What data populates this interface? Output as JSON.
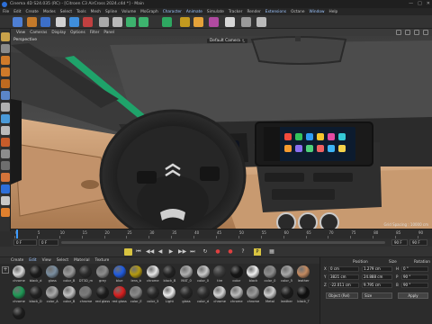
{
  "window": {
    "title": "Cinema 4D S24.035 (RC) - [Citroen C3 AirCross 2024.c4d *] - Main",
    "controls": [
      "—",
      "□",
      "✕"
    ]
  },
  "menu": [
    "File",
    "Edit",
    "Create",
    "Modes",
    "Select",
    "Tools",
    "Mesh",
    "Spline",
    "Volume",
    "MoGraph",
    "Character",
    "Animate",
    "Simulate",
    "Tracker",
    "Render",
    "Extensions",
    "Octane",
    "Window",
    "Help"
  ],
  "viewport": {
    "menu": [
      "View",
      "Cameras",
      "Display",
      "Options",
      "Filter",
      "Panel"
    ],
    "label": "Perspective",
    "camera": "Default Camera ⚬̲",
    "grid_spacing": "Grid Spacing : 10000 cm",
    "screen_apps": [
      "#f04b3c",
      "#33c35a",
      "#2f9cf3",
      "#f7c52d",
      "#e54aa3",
      "#35c9d6",
      "#f39a2f",
      "#8a6ef0",
      "#4ed17a",
      "#f06060",
      "#3db5f5",
      "#f5d24a"
    ]
  },
  "timeline": {
    "ticks": [
      "0",
      "5",
      "10",
      "15",
      "20",
      "25",
      "30",
      "35",
      "40",
      "45",
      "50",
      "55",
      "60",
      "65",
      "70",
      "75",
      "80",
      "85",
      "90"
    ],
    "current_frame": "0 F",
    "start": "0 F",
    "end": "90 F",
    "end2": "90 F"
  },
  "transport": [
    "⏮",
    "◀◀",
    "◀",
    "▶",
    "▶▶",
    "⏭",
    "↻",
    "●",
    "●",
    "?",
    "P",
    "▦"
  ],
  "materials": {
    "menu": [
      "Create",
      "Edit",
      "View",
      "Select",
      "Material",
      "Texture"
    ],
    "highlight_index": 1,
    "row1": [
      {
        "name": "chrome",
        "color": "#d8d8d8"
      },
      {
        "name": "black_d",
        "color": "#1a1a1a"
      },
      {
        "name": "glass",
        "color": "#7a8ea0"
      },
      {
        "name": "color_B",
        "color": "#9a9a9a"
      },
      {
        "name": "DT3D_m",
        "color": "#2a2a2a"
      },
      {
        "name": "grey",
        "color": "#8c8c8c"
      },
      {
        "name": "blue",
        "color": "#1f5be0"
      },
      {
        "name": "lens_b",
        "color": "#b49a10"
      },
      {
        "name": "chrome",
        "color": "#e6e6e6"
      },
      {
        "name": "black_B",
        "color": "#222"
      },
      {
        "name": "MAT_0",
        "color": "#b0b0b0"
      },
      {
        "name": "color_0",
        "color": "#c9c9c9"
      },
      {
        "name": "tire",
        "color": "#3a3a3a"
      },
      {
        "name": "color",
        "color": "#151515"
      },
      {
        "name": "black",
        "color": "#f0f0f0"
      },
      {
        "name": "color_0",
        "color": "#8d8d8d"
      },
      {
        "name": "color_5",
        "color": "#a8a8a8"
      },
      {
        "name": "leather",
        "color": "#c48a60"
      }
    ],
    "row2": [
      {
        "name": "chrome",
        "color": "#1f9a56"
      },
      {
        "name": "black_D",
        "color": "#202020"
      },
      {
        "name": "color_A",
        "color": "#a9a9a9"
      },
      {
        "name": "color_B",
        "color": "#c2c2c2"
      },
      {
        "name": "chrome",
        "color": "#7b7b7b"
      },
      {
        "name": "red glass",
        "color": "#1c1c1c"
      },
      {
        "name": "red glass",
        "color": "#d91e1e"
      },
      {
        "name": "color_E",
        "color": "#8a8a8a"
      },
      {
        "name": "color_3",
        "color": "#262626"
      },
      {
        "name": "Light",
        "color": "#ececec"
      },
      {
        "name": "glass",
        "color": "#262626"
      },
      {
        "name": "color_d",
        "color": "#2b2b2b"
      },
      {
        "name": "chrome",
        "color": "#d5d5d5"
      },
      {
        "name": "chrome",
        "color": "#bcbcbc"
      },
      {
        "name": "chrome",
        "color": "#9a9a9a"
      },
      {
        "name": "Metal",
        "color": "#cfcfcf"
      },
      {
        "name": "leather",
        "color": "#1b1b1b"
      },
      {
        "name": "black_T",
        "color": "#0f0f0f"
      }
    ],
    "row3": [
      {
        "name": "",
        "color": "#1c1c1c"
      }
    ]
  },
  "coordinates": {
    "headers": [
      "Position",
      "Size",
      "Rotation"
    ],
    "rows": [
      {
        "axis": "X",
        "pos": "0 cm",
        "size": "1.279 cm",
        "rot_axis": "H",
        "rot": "0 °"
      },
      {
        "axis": "Y",
        "pos": "3821 cm",
        "size": "24.888 cm",
        "rot_axis": "P",
        "rot": "90 °"
      },
      {
        "axis": "Z",
        "pos": "-22.011 cm",
        "size": "9.795 cm",
        "rot_axis": "B",
        "rot": "90 °"
      }
    ],
    "mode": "Object (Rel)",
    "size_mode": "Size",
    "apply": "Apply"
  },
  "toolbar_colors": [
    "#4e7fd4",
    "#c57a2a",
    "#3c6fc9",
    "#d1d1d1",
    "#3f8edb",
    "#c04040",
    "#aaa",
    "#b8b8b8",
    "#3db36e",
    "#3db36e",
    "#2ea861",
    "#c39a1f",
    "#e4a23a",
    "#b04aa0",
    "#d6d6d6",
    "#9a9a9a",
    "#bbbbbb"
  ]
}
